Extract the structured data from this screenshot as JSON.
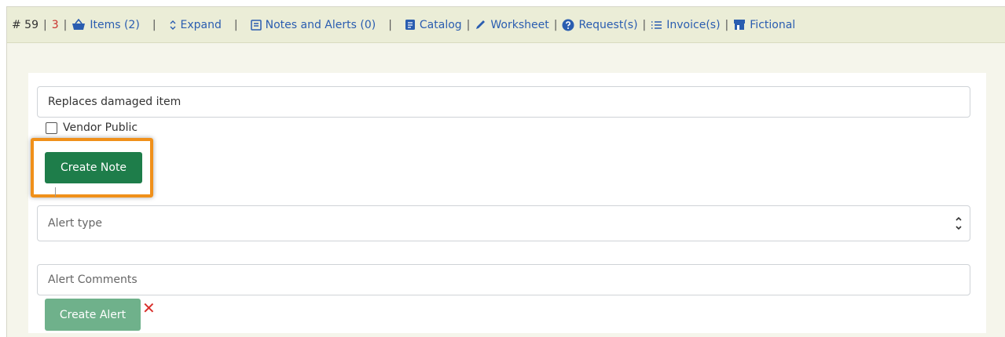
{
  "topbar": {
    "po_number": "# 59",
    "count_red": "3",
    "items_label": "Items (2)",
    "expand_label": "Expand",
    "notes_label": "Notes and Alerts (0)",
    "catalog_label": "Catalog",
    "worksheet_label": "Worksheet",
    "requests_label": "Request(s)",
    "invoices_label": "Invoice(s)",
    "fictional_label": "Fictional"
  },
  "note": {
    "value": "Replaces damaged item",
    "vendor_public_label": "Vendor Public",
    "create_label": "Create Note"
  },
  "alert": {
    "type_placeholder": "Alert type",
    "comments_placeholder": "Alert Comments",
    "create_label": "Create Alert",
    "remove_glyph": "✕"
  },
  "colors": {
    "link": "#2a5db0",
    "note_button": "#1e7d4a",
    "alert_button": "#6fb18b",
    "highlight": "#f0901a",
    "count": "#c9302c"
  }
}
